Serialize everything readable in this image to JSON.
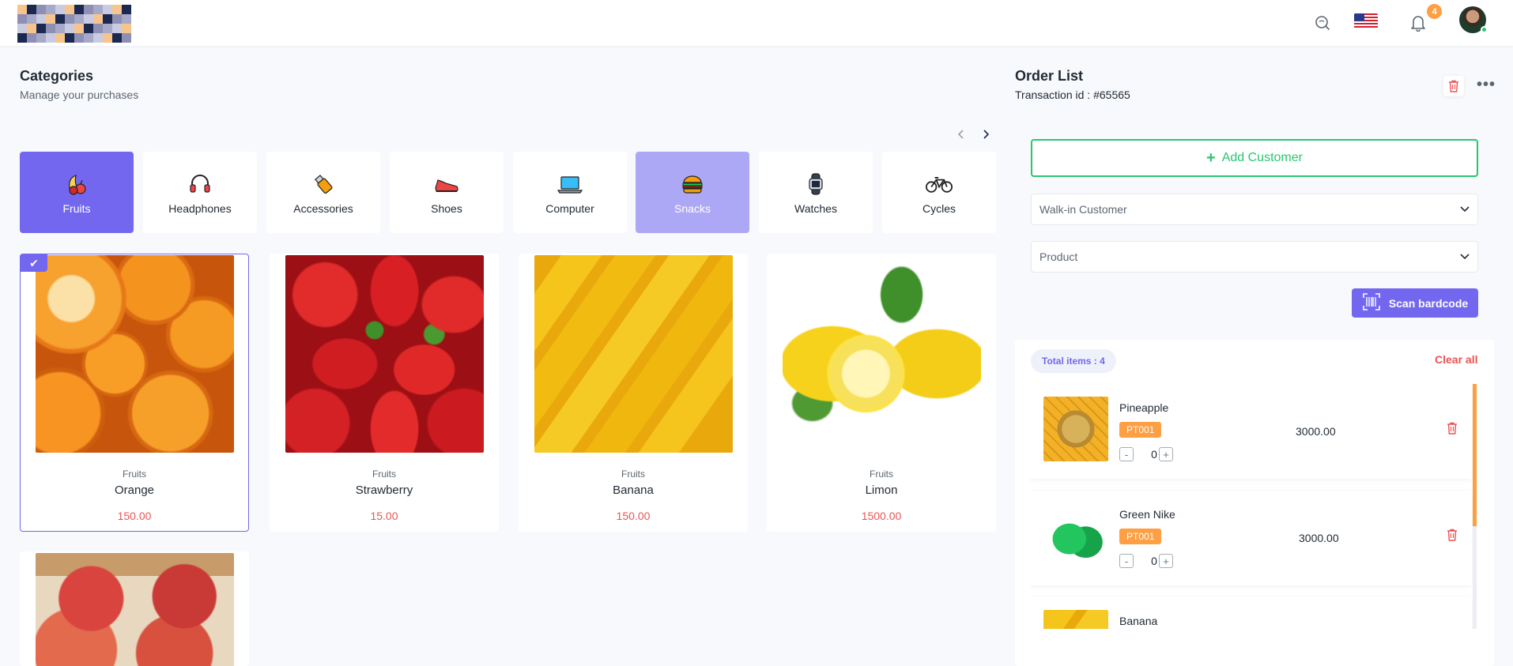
{
  "header": {
    "notifications_count": "4",
    "icons": [
      "search-icon",
      "us-flag-icon",
      "bell-icon",
      "user-avatar"
    ]
  },
  "categories": {
    "title": "Categories",
    "subtitle": "Manage your purchases",
    "items": [
      {
        "label": "Fruits",
        "icon": "fruits-icon"
      },
      {
        "label": "Headphones",
        "icon": "headphones-icon"
      },
      {
        "label": "Accessories",
        "icon": "usb-icon"
      },
      {
        "label": "Shoes",
        "icon": "sneaker-icon"
      },
      {
        "label": "Computer",
        "icon": "laptop-icon"
      },
      {
        "label": "Snacks",
        "icon": "burger-icon"
      },
      {
        "label": "Watches",
        "icon": "smartwatch-icon"
      },
      {
        "label": "Cycles",
        "icon": "bicycle-icon"
      }
    ],
    "active": "Fruits",
    "highlighted": "Snacks"
  },
  "products": [
    {
      "category": "Fruits",
      "name": "Orange",
      "price": "150.00",
      "selected": true
    },
    {
      "category": "Fruits",
      "name": "Strawberry",
      "price": "15.00",
      "selected": false
    },
    {
      "category": "Fruits",
      "name": "Banana",
      "price": "150.00",
      "selected": false
    },
    {
      "category": "Fruits",
      "name": "Limon",
      "price": "1500.00",
      "selected": false
    },
    {
      "category": "",
      "name": "",
      "price": "",
      "selected": false
    }
  ],
  "order": {
    "title": "Order List",
    "transaction": "Transaction id : #65565",
    "add_customer_label": "Add Customer",
    "customer_select": "Walk-in Customer",
    "product_select": "Product",
    "scan_label": "Scan bardcode",
    "total_items": "Total items : 4",
    "clear_all": "Clear all",
    "items": [
      {
        "name": "Pineapple",
        "code": "PT001",
        "qty": "0",
        "price": "3000.00"
      },
      {
        "name": "Green Nike",
        "code": "PT001",
        "qty": "0",
        "price": "3000.00"
      },
      {
        "name": "Banana",
        "code": "",
        "qty": "",
        "price": ""
      }
    ]
  },
  "colors": {
    "accent": "#7367f0",
    "success": "#28c76f",
    "danger": "#ea5455",
    "warning": "#fe9f43"
  }
}
